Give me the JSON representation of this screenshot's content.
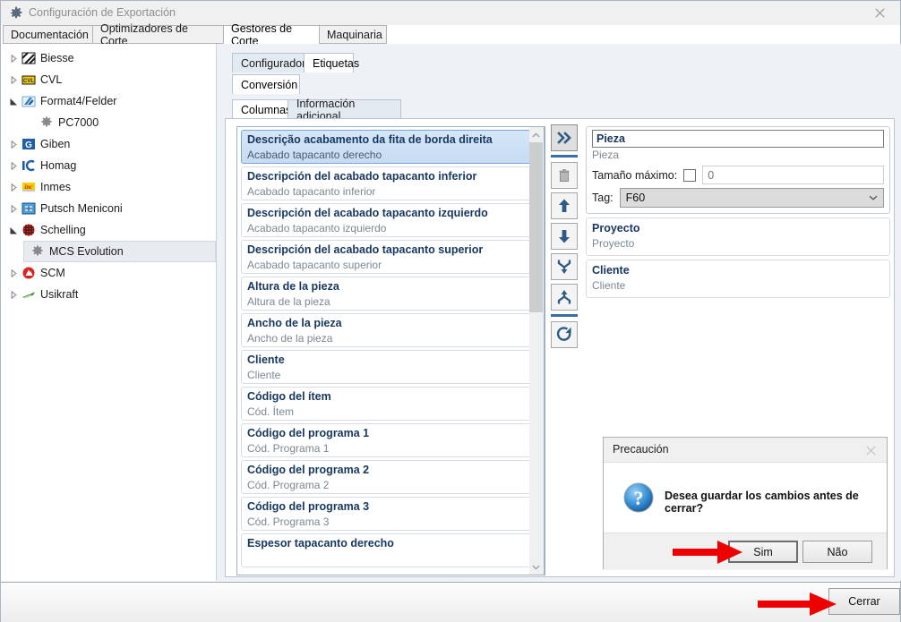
{
  "window": {
    "title": "Configuración de Exportación",
    "gear_icon": "gear-icon",
    "close_icon": "✕"
  },
  "outer_tabs": [
    {
      "label": "Documentación",
      "active": false
    },
    {
      "label": "Optimizadores de Corte",
      "active": false
    },
    {
      "label": "Gestores de Corte",
      "active": true
    },
    {
      "label": "Maquinaria",
      "active": false
    }
  ],
  "tree": [
    {
      "label": "Biesse",
      "level": 0,
      "expandable": true,
      "expanded": false,
      "icon": "biesse-icon",
      "selected": false
    },
    {
      "label": "CVL",
      "level": 0,
      "expandable": true,
      "expanded": false,
      "icon": "cvl-icon",
      "selected": false
    },
    {
      "label": "Format4/Felder",
      "level": 0,
      "expandable": true,
      "expanded": true,
      "icon": "format4-icon",
      "selected": false
    },
    {
      "label": "PC7000",
      "level": 1,
      "expandable": false,
      "expanded": false,
      "icon": "gear-icon",
      "selected": false
    },
    {
      "label": "Giben",
      "level": 0,
      "expandable": true,
      "expanded": false,
      "icon": "giben-icon",
      "selected": false
    },
    {
      "label": "Homag",
      "level": 0,
      "expandable": true,
      "expanded": false,
      "icon": "homag-icon",
      "selected": false
    },
    {
      "label": "Inmes",
      "level": 0,
      "expandable": true,
      "expanded": false,
      "icon": "inmes-icon",
      "selected": false
    },
    {
      "label": "Putsch Meniconi",
      "level": 0,
      "expandable": true,
      "expanded": false,
      "icon": "putsch-icon",
      "selected": false
    },
    {
      "label": "Schelling",
      "level": 0,
      "expandable": true,
      "expanded": true,
      "icon": "schelling-icon",
      "selected": false
    },
    {
      "label": "MCS Evolution",
      "level": 1,
      "expandable": false,
      "expanded": false,
      "icon": "gear-icon",
      "selected": true
    },
    {
      "label": "SCM",
      "level": 0,
      "expandable": true,
      "expanded": false,
      "icon": "scm-icon",
      "selected": false
    },
    {
      "label": "Usikraft",
      "level": 0,
      "expandable": true,
      "expanded": false,
      "icon": "usikraft-icon",
      "selected": false
    }
  ],
  "level2_tabs": [
    {
      "label": "Configurador",
      "active": false
    },
    {
      "label": "Etiquetas",
      "active": true
    }
  ],
  "level3_tabs": [
    {
      "label": "Conversión",
      "active": true
    }
  ],
  "level4_tabs": [
    {
      "label": "Columnas",
      "active": true
    },
    {
      "label": "Información adicional",
      "active": false
    }
  ],
  "columns_list": [
    {
      "title": "Descrição acabamento da fita de borda direita",
      "subtitle": "Acabado tapacanto derecho",
      "selected": true
    },
    {
      "title": "Descripción del acabado tapacanto inferior",
      "subtitle": "Acabado tapacanto inferior",
      "selected": false
    },
    {
      "title": "Descripción del acabado tapacanto izquierdo",
      "subtitle": "Acabado tapacanto izquierdo",
      "selected": false
    },
    {
      "title": "Descripción del acabado tapacanto superior",
      "subtitle": "Acabado tapacanto superior",
      "selected": false
    },
    {
      "title": "Altura de la pieza",
      "subtitle": "Altura de la pieza",
      "selected": false
    },
    {
      "title": "Ancho de la pieza",
      "subtitle": "Ancho de la pieza",
      "selected": false
    },
    {
      "title": "Cliente",
      "subtitle": "Cliente",
      "selected": false
    },
    {
      "title": "Código del ítem",
      "subtitle": "Cód. Ítem",
      "selected": false
    },
    {
      "title": "Código del programa 1",
      "subtitle": "Cód. Programa 1",
      "selected": false
    },
    {
      "title": "Código del programa 2",
      "subtitle": "Cód. Programa 2",
      "selected": false
    },
    {
      "title": "Código del programa 3",
      "subtitle": "Cód. Programa 3",
      "selected": false
    },
    {
      "title": "Espesor tapacanto derecho",
      "subtitle": "",
      "selected": false
    }
  ],
  "transfer_buttons": [
    {
      "name": "add-all-button",
      "icon": "double-chevron-right-icon",
      "pressed": true
    },
    {
      "name": "delete-button",
      "icon": "trash-icon",
      "pressed": false
    },
    {
      "name": "move-up-button",
      "icon": "arrow-up-icon",
      "pressed": false
    },
    {
      "name": "move-down-button",
      "icon": "arrow-down-icon",
      "pressed": false
    },
    {
      "name": "merge-button",
      "icon": "merge-down-icon",
      "pressed": false
    },
    {
      "name": "split-button",
      "icon": "split-up-icon",
      "pressed": false
    },
    {
      "name": "refresh-button",
      "icon": "refresh-icon",
      "pressed": false
    }
  ],
  "field_panel": {
    "active_field": {
      "value": "Pieza",
      "subtitle": "Pieza",
      "max_size_label": "Tamaño máximo:",
      "max_size_checked": false,
      "max_size_value": "0",
      "max_size_placeholder": "0",
      "tag_label": "Tag:",
      "tag_value": "F60"
    },
    "other_fields": [
      {
        "title": "Proyecto",
        "subtitle": "Proyecto"
      },
      {
        "title": "Cliente",
        "subtitle": "Cliente"
      }
    ]
  },
  "bottom": {
    "close_button": "Cerrar"
  },
  "dialog": {
    "title": "Precaución",
    "close_icon": "✕",
    "icon": "question-icon",
    "message": "Desea guardar los cambios antes de cerrar?",
    "yes_button": "Sim",
    "no_button": "Não"
  },
  "colors": {
    "accent": "#3a6ea5",
    "selection": "#c5dcf4",
    "list_title": "#17375e",
    "annotation_red": "#ee0000"
  }
}
